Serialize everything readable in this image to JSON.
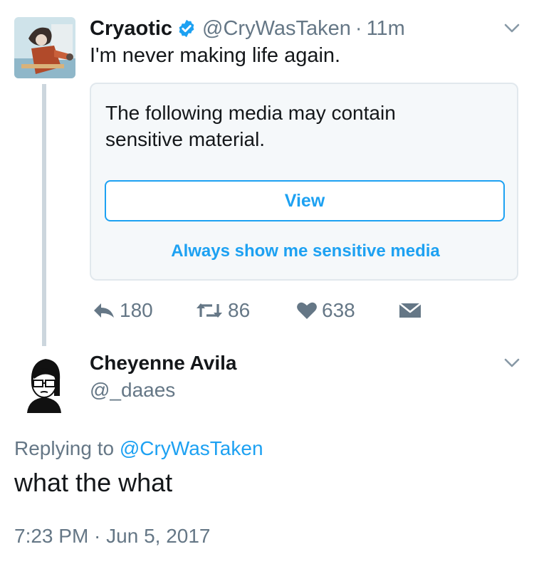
{
  "tweet": {
    "author_name": "Cryaotic",
    "author_handle": "@CryWasTaken",
    "separator": "·",
    "time_ago": "11m",
    "verified_icon": "verified-badge-icon",
    "text": "I'm never making life again.",
    "media": {
      "warning": "The following media may contain sensitive material.",
      "view_label": "View",
      "always_show_label": "Always show me sensitive media"
    },
    "actions": {
      "reply_count": "180",
      "retweet_count": "86",
      "like_count": "638"
    }
  },
  "reply": {
    "author_name": "Cheyenne Avila",
    "author_handle": "@_daaes",
    "replying_prefix": "Replying to",
    "replying_to": "@CryWasTaken",
    "text": "what the what",
    "timestamp": "7:23 PM · Jun 5, 2017"
  },
  "colors": {
    "accent": "#1da1f2",
    "secondary_text": "#657786",
    "primary_text": "#14171a",
    "card_background": "#f5f8fa",
    "thread_line": "#ccd6dd"
  }
}
